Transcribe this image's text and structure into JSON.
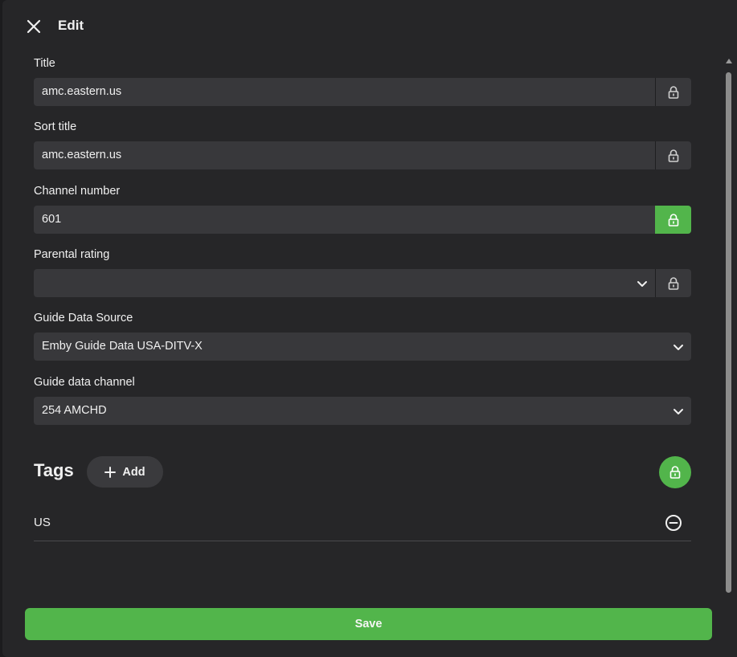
{
  "header": {
    "title": "Edit",
    "close_icon": "close-icon"
  },
  "fields": {
    "title": {
      "label": "Title",
      "value": "amc.eastern.us",
      "locked": false
    },
    "sort_title": {
      "label": "Sort title",
      "value": "amc.eastern.us",
      "locked": false
    },
    "channel_number": {
      "label": "Channel number",
      "value": "601",
      "locked": true
    },
    "parental_rating": {
      "label": "Parental rating",
      "value": "",
      "locked": false
    },
    "guide_data_source": {
      "label": "Guide Data Source",
      "value": "Emby Guide Data USA-DITV-X"
    },
    "guide_data_channel": {
      "label": "Guide data channel",
      "value": "254 AMCHD"
    }
  },
  "tags": {
    "title": "Tags",
    "add_label": "Add",
    "locked": true,
    "items": [
      {
        "label": "US"
      }
    ]
  },
  "footer": {
    "save_label": "Save"
  },
  "colors": {
    "accent": "#52b54b",
    "panel": "#262628",
    "input": "#38383b"
  }
}
